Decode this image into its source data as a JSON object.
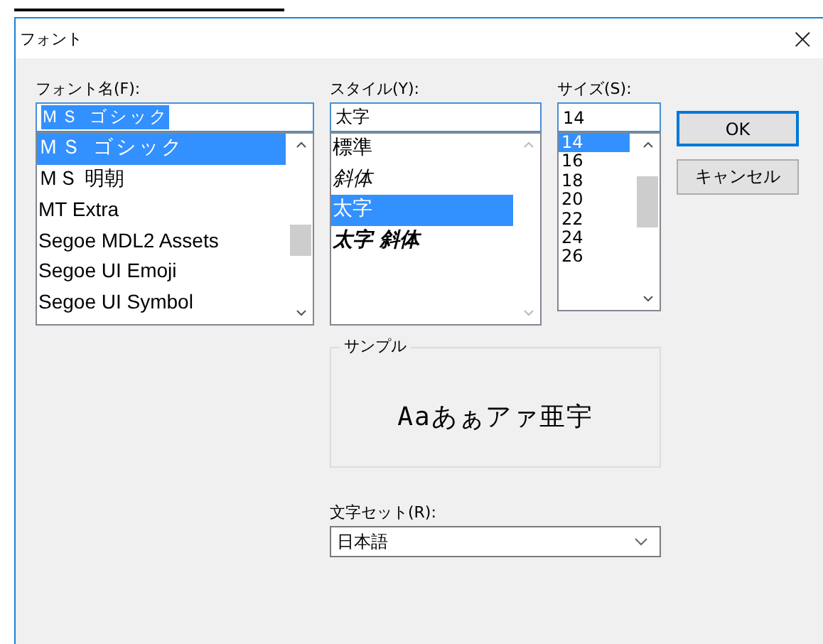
{
  "window": {
    "title": "フォント",
    "close": "×"
  },
  "font_name": {
    "label": "フォント名(F):",
    "value": "ＭＳ ゴシック",
    "items": [
      {
        "text": "ＭＳ ゴシック",
        "kind": "gothic",
        "selected": true
      },
      {
        "text": "ＭＳ 明朝",
        "kind": "serif",
        "selected": false
      },
      {
        "text": "MT Extra",
        "kind": "sans",
        "selected": false
      },
      {
        "text": "Segoe MDL2 Assets",
        "kind": "sans",
        "selected": false
      },
      {
        "text": "Segoe UI Emoji",
        "kind": "sans",
        "selected": false
      },
      {
        "text": "Segoe UI Symbol",
        "kind": "sans",
        "selected": false
      }
    ]
  },
  "style": {
    "label": "スタイル(Y):",
    "value": "太字",
    "items": [
      {
        "text": "標準",
        "kind": "regular",
        "selected": false
      },
      {
        "text": "斜体",
        "kind": "italic",
        "selected": false
      },
      {
        "text": "太字",
        "kind": "bold",
        "selected": true
      },
      {
        "text": "太字 斜体",
        "kind": "bold_italic",
        "selected": false
      }
    ]
  },
  "size": {
    "label": "サイズ(S):",
    "value": "14",
    "items": [
      {
        "text": "14",
        "selected": true
      },
      {
        "text": "16",
        "selected": false
      },
      {
        "text": "18",
        "selected": false
      },
      {
        "text": "20",
        "selected": false
      },
      {
        "text": "22",
        "selected": false
      },
      {
        "text": "24",
        "selected": false
      },
      {
        "text": "26",
        "selected": false
      }
    ]
  },
  "buttons": [
    {
      "label": "OK",
      "default": true
    },
    {
      "label": "キャンセル",
      "default": false
    }
  ],
  "sample": {
    "label": "サンプル",
    "text": "Aaあぁアァ亜宇"
  },
  "charset": {
    "label": "文字セット(R):",
    "value": "日本語"
  }
}
